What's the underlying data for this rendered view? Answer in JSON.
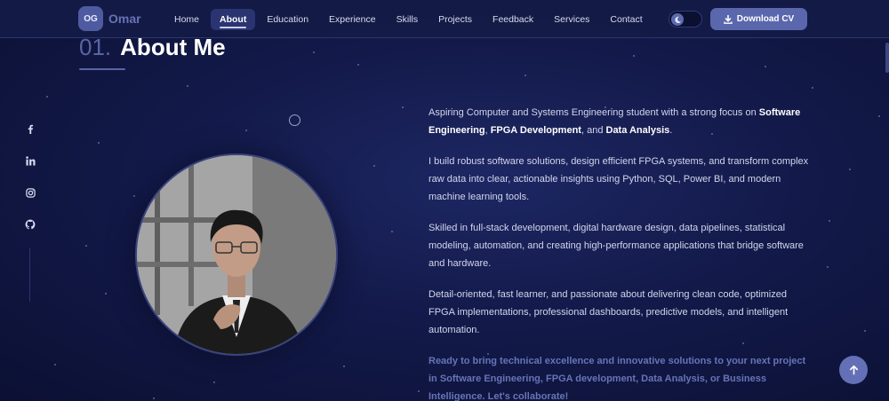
{
  "navbar": {
    "brand_badge": "OG",
    "brand_name": "Omar",
    "links": [
      "Home",
      "About",
      "Education",
      "Experience",
      "Skills",
      "Projects",
      "Feedback",
      "Services",
      "Contact"
    ],
    "active_link": "About",
    "download_label": "Download CV"
  },
  "heading": {
    "number": "01.",
    "title": "About Me"
  },
  "social_icons": [
    "facebook-icon",
    "linkedin-icon",
    "instagram-icon",
    "github-icon"
  ],
  "about": {
    "p1_a": "Aspiring Computer and Systems Engineering student with a strong focus on ",
    "p1_b": "Software Engineering",
    "p1_c": ", ",
    "p1_d": "FPGA Development",
    "p1_e": ", and ",
    "p1_f": "Data Analysis",
    "p1_g": ".",
    "p2": "I build robust software solutions, design efficient FPGA systems, and transform complex raw data into clear, actionable insights using Python, SQL, Power BI, and modern machine learning tools.",
    "p3": "Skilled in full-stack development, digital hardware design, data pipelines, statistical modeling, automation, and creating high-performance applications that bridge software and hardware.",
    "p4": "Detail-oriented, fast learner, and passionate about delivering clean code, optimized FPGA implementations, professional dashboards, predictive models, and intelligent automation.",
    "p5": "Ready to bring technical excellence and innovative solutions to your next project in Software Engineering, FPGA development, Data Analysis, or Business Intelligence. Let's collaborate!"
  },
  "colors": {
    "accent": "#5a67ad",
    "background": "#131a4a",
    "cta_text": "#6774b8"
  }
}
